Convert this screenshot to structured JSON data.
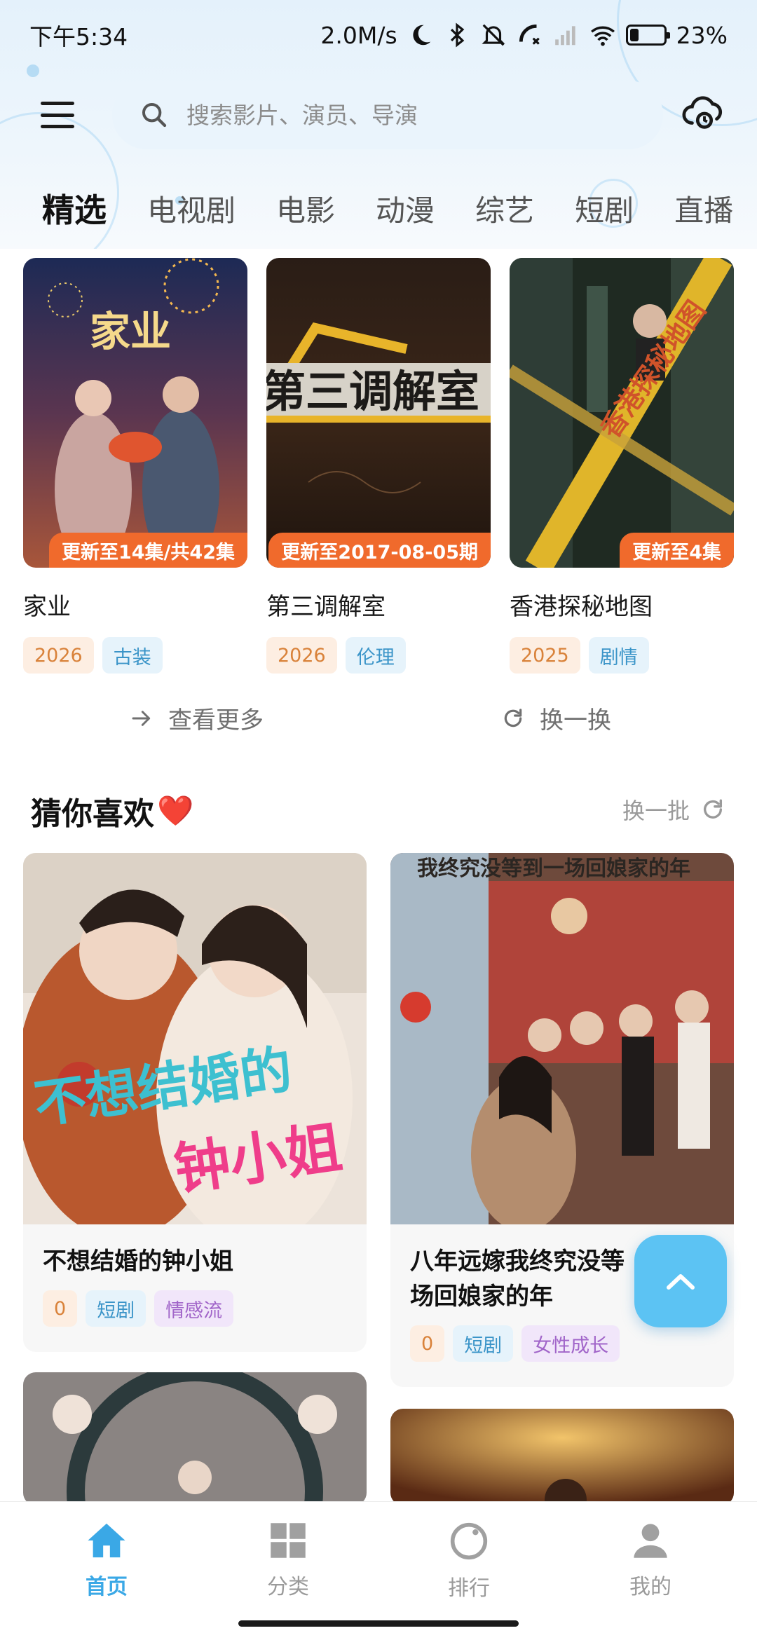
{
  "status_bar": {
    "time": "下午5:34",
    "net_speed": "2.0M/s",
    "battery": "23%",
    "battery_level": 0.23
  },
  "header": {
    "search_placeholder": "搜索影片、演员、导演"
  },
  "tabs": [
    "精选",
    "电视剧",
    "电影",
    "动漫",
    "综艺",
    "短剧",
    "直播"
  ],
  "featured": [
    {
      "title": "家业",
      "badge": "更新至14集/共42集",
      "year": "2026",
      "genre": "古装"
    },
    {
      "title": "第三调解室",
      "badge": "更新至2017-08-05期",
      "year": "2026",
      "genre": "伦理"
    },
    {
      "title": "香港探秘地图",
      "badge": "更新至4集",
      "year": "2025",
      "genre": "剧情"
    }
  ],
  "actions": {
    "more": "查看更多",
    "swap": "换一换"
  },
  "guess": {
    "title": "猜你喜欢",
    "heart": "❤️",
    "refresh": "换一批",
    "items": [
      {
        "title": "不想结婚的钟小姐",
        "score": "0",
        "tag1": "短剧",
        "tag2": "情感流"
      },
      {
        "title": "八年远嫁我终究没等到一场回娘家的年",
        "title_display": "八年远嫁我终究没等\n场回娘家的年",
        "score": "0",
        "tag1": "短剧",
        "tag2": "女性成长"
      }
    ]
  },
  "bottom_nav": [
    {
      "label": "首页",
      "icon": "home-icon"
    },
    {
      "label": "分类",
      "icon": "grid-icon"
    },
    {
      "label": "排行",
      "icon": "ranking-icon"
    },
    {
      "label": "我的",
      "icon": "profile-icon"
    }
  ],
  "colors": {
    "accent": "#3aa8e6",
    "badge_orange": "#f06a2c",
    "to_top": "#5cc3f3"
  }
}
